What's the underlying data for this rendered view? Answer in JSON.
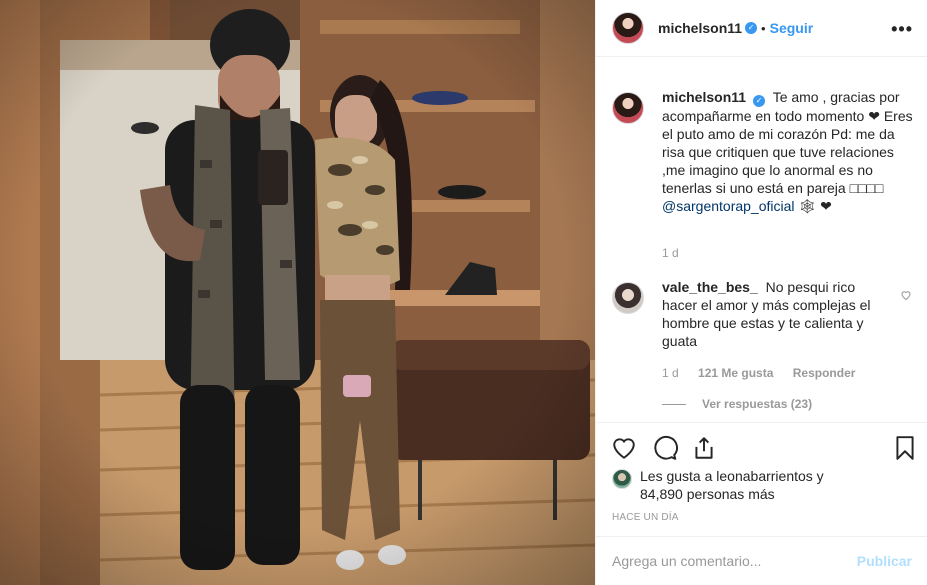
{
  "post": {
    "image_alt": "",
    "header": {
      "username": "michelson11",
      "separator": "•",
      "follow_label": "Seguir",
      "more_label": "•••",
      "verified_icon": "verified-badge-icon"
    },
    "caption": {
      "username": "michelson11",
      "text_before_mention": "Te amo , gracias por acompañarme en todo momento ❤ Eres el puto amo de mi corazón Pd: me da risa que critiquen que tuve relaciones ,me imagino que lo anormal es no tenerlas si uno está en pareja □□□□",
      "mention": "@sargentorap_oficial",
      "text_after_mention": "🕸 ❤",
      "time": "1 d"
    },
    "comments": [
      {
        "username": "vale_the_bes_",
        "text": "No pesqui rico hacer el amor y más complejas el hombre que estas y te calienta y guata",
        "time": "1 d",
        "likes": "121 Me gusta",
        "reply_label": "Responder",
        "view_replies": "Ver respuestas (23)"
      }
    ],
    "actions": {
      "like_icon": "heart-icon",
      "comment_icon": "comment-icon",
      "share_icon": "share-icon",
      "save_icon": "bookmark-icon"
    },
    "likes_summary": {
      "line1": "Les gusta a leonabarrientos y",
      "line2": "84,890 personas más"
    },
    "posted_ago": "HACE UN DÍA",
    "add_comment": {
      "placeholder": "Agrega un comentario...",
      "publish_label": "Publicar"
    }
  },
  "colors": {
    "accent": "#3897f0",
    "publish_disabled": "#b2dffc",
    "muted": "#999999",
    "text": "#262626",
    "border": "#efefef"
  }
}
